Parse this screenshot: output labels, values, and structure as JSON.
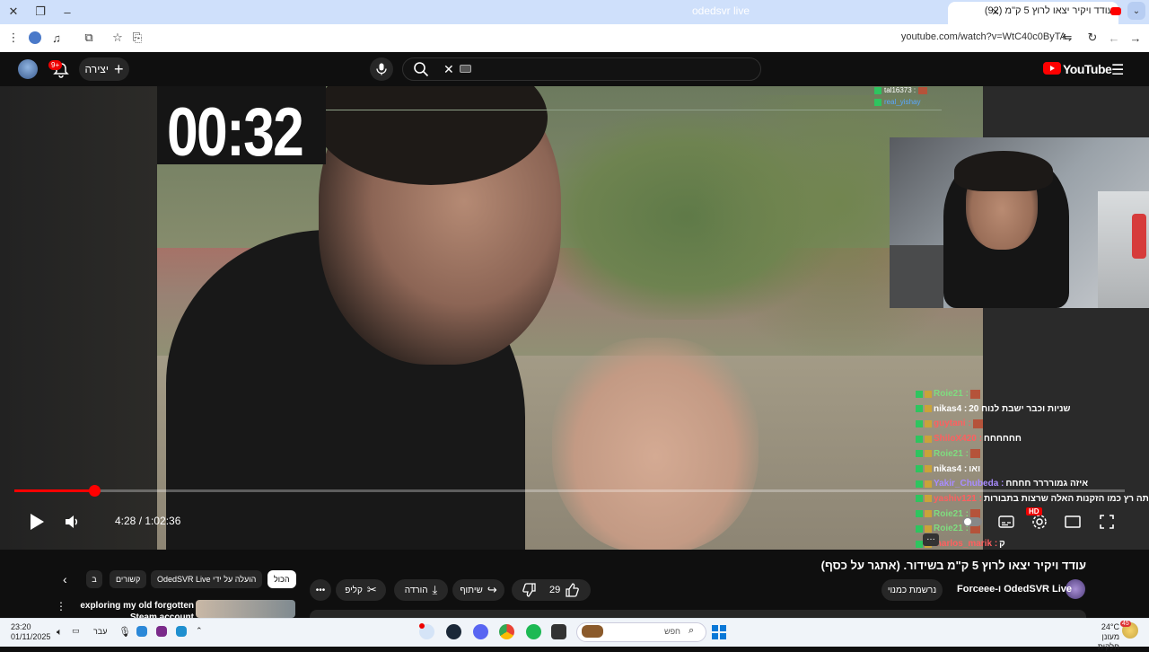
{
  "browser": {
    "tab_title": "עודד ויקיר יצאו לרוץ 5 ק\"מ (92)",
    "url": "youtube.com/watch?v=WtC40c0ByTA"
  },
  "header": {
    "search_query": "odedsvr live",
    "create_label": "יצירה",
    "notifications_badge": "9+",
    "logo_text": "YouTube"
  },
  "player": {
    "overlay_timer": "00:32",
    "time_display": "4:28 / 1:02:36",
    "progress": 0.072,
    "quality_badge": "HD"
  },
  "chat_top": [
    {
      "user": "tal16373 :",
      "color": "#ffffff"
    },
    {
      "user": "real_yishay",
      "color": "#5aa8ff"
    }
  ],
  "chat": [
    {
      "user": "Roie21 :",
      "color": "#7fdc7f",
      "msg": "",
      "emote": true
    },
    {
      "user": "nikas4 :",
      "color": "#ffffff",
      "msg": "שניות וכבר ישבת לנוח 20",
      "emote": false
    },
    {
      "user": "guytani :",
      "color": "#ff5f5f",
      "msg": "",
      "emote": true
    },
    {
      "user": "ShiloX420 :",
      "color": "#ff5f5f",
      "msg": "חחחחחח",
      "emote": false
    },
    {
      "user": "Roie21 :",
      "color": "#7fdc7f",
      "msg": "",
      "emote": true
    },
    {
      "user": "nikas4 :",
      "color": "#ffffff",
      "msg": "ואו",
      "emote": false
    },
    {
      "user": "Yakir_Chubeda :",
      "color": "#a88cff",
      "msg": "איזה גמורררר חחחח",
      "emote": false
    },
    {
      "user": "yashiv121 :",
      "color": "#ff5f5f",
      "msg": "אתה רץ כמו הזקנות האלה שרצות בתבורות",
      "emote": false
    },
    {
      "user": "Roie21 :",
      "color": "#7fdc7f",
      "msg": "",
      "emote": true
    },
    {
      "user": "Roie21 :",
      "color": "#7fdc7f",
      "msg": "",
      "emote": true
    },
    {
      "user": "marlos_marik :",
      "color": "#ff5f5f",
      "msg": "ק",
      "emote": false
    }
  ],
  "video": {
    "title": "עודד ויקיר יצאו לרוץ 5 ק\"מ בשידור. (אתגר על כסף)",
    "channel": "OdedSVR Live ו-Forceee",
    "subscribe_label": "נרשמת כמנוי",
    "likes": "29",
    "share_label": "שיתוף",
    "download_label": "הורדה",
    "clip_label": "קליפ"
  },
  "filters": {
    "all": "הכול",
    "uploaded_by": "הועלה על ידי OdedSVR Live",
    "related": "קשורים",
    "partial": "ב"
  },
  "recommendation": {
    "title": "exploring my old forgotten Steam account"
  },
  "taskbar": {
    "time": "23:20",
    "date": "01/11/2025",
    "lang": "עבר",
    "search_placeholder": "חפש",
    "weather_temp": "24°C",
    "weather_desc": "מעונן חלקית",
    "weather_badge": "45"
  }
}
